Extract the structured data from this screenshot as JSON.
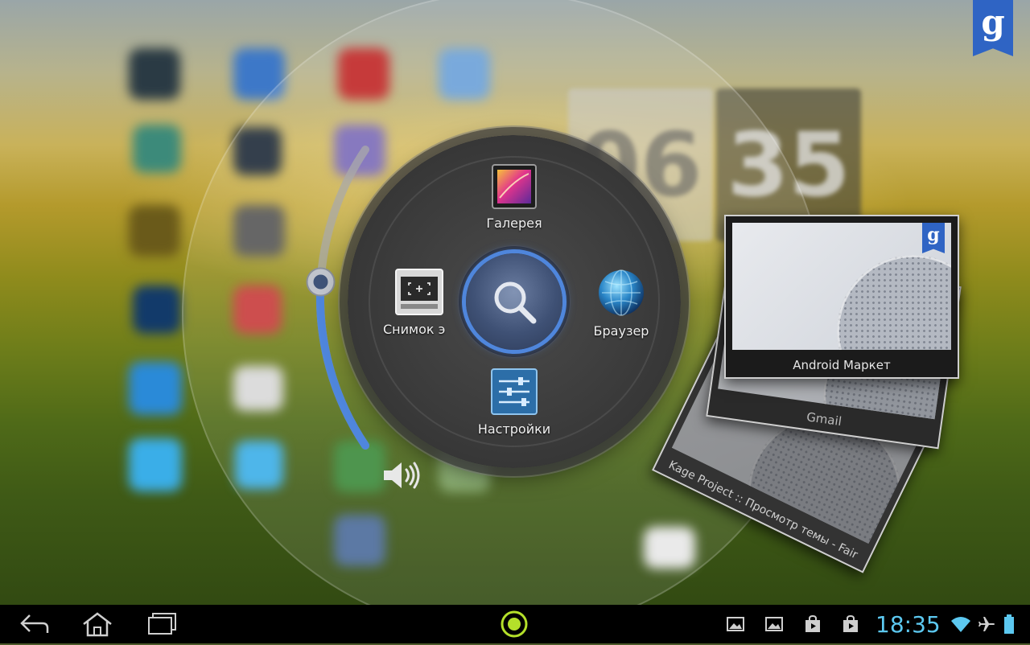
{
  "homescreen": {
    "clock_widget": {
      "hours": "06",
      "minutes": "35"
    },
    "google_search_letter": "g"
  },
  "pie_menu": {
    "center": {
      "icon": "search-icon"
    },
    "items": [
      {
        "label": "Галерея",
        "icon": "gallery-icon"
      },
      {
        "label": "Браузер",
        "icon": "browser-globe-icon"
      },
      {
        "label": "Настройки",
        "icon": "settings-sliders-icon"
      },
      {
        "label": "Снимок э",
        "icon": "screenshot-icon"
      }
    ]
  },
  "volume": {
    "level": 0.55,
    "icon": "speaker-icon",
    "accent": "#4f86dc"
  },
  "recent_apps": [
    {
      "title": "Android Маркет",
      "badge": "g"
    },
    {
      "title": "Gmail"
    },
    {
      "title": "Kage Project :: Просмотр темы - Fair"
    }
  ],
  "navbar": {
    "back": "back-icon",
    "home": "home-icon",
    "recent": "recent-apps-icon",
    "launcher": "circle-launcher-icon",
    "notifications": [
      "image-icon",
      "image-icon",
      "market-bag-icon",
      "market-bag-icon"
    ],
    "time": "18:35",
    "status_icons": [
      "wifi-icon",
      "airplane-icon",
      "battery-icon"
    ],
    "accent": "#5cc8f0"
  }
}
